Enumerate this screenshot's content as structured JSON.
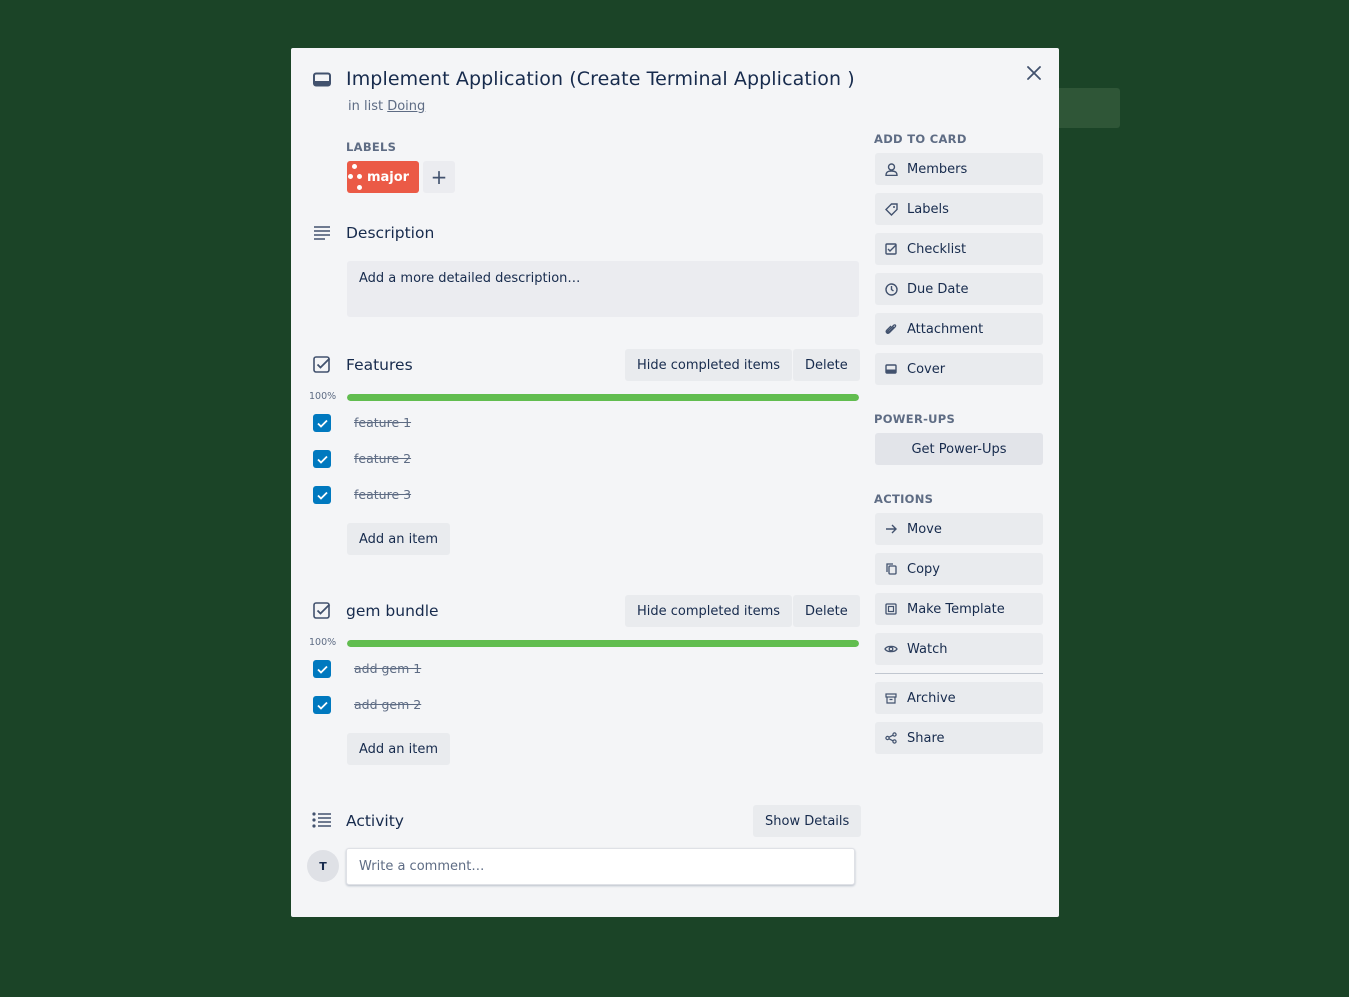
{
  "card": {
    "title": "Implement Application (Create Terminal Application )",
    "in_list_prefix": "in list",
    "list_name": "Doing"
  },
  "labels": {
    "heading": "LABELS",
    "items": [
      {
        "name": "major",
        "color": "#eb5a46"
      }
    ],
    "add_symbol": "+"
  },
  "description": {
    "title": "Description",
    "placeholder": "Add a more detailed description…"
  },
  "checklists": [
    {
      "title": "Features",
      "progress_label": "100%",
      "progress": 1.0,
      "hide_label": "Hide completed items",
      "delete_label": "Delete",
      "items": [
        {
          "text": "feature 1",
          "checked": true
        },
        {
          "text": "feature 2",
          "checked": true
        },
        {
          "text": "feature 3",
          "checked": true
        }
      ],
      "add_item_label": "Add an item"
    },
    {
      "title": "gem bundle",
      "progress_label": "100%",
      "progress": 1.0,
      "hide_label": "Hide completed items",
      "delete_label": "Delete",
      "items": [
        {
          "text": "add gem 1",
          "checked": true
        },
        {
          "text": "add gem 2",
          "checked": true
        }
      ],
      "add_item_label": "Add an item"
    }
  ],
  "activity": {
    "title": "Activity",
    "show_details_label": "Show Details",
    "avatar_initial": "T",
    "comment_placeholder": "Write a comment…"
  },
  "sidebar": {
    "add_to_card_heading": "ADD TO CARD",
    "add_to_card": [
      {
        "label": "Members",
        "icon": "person-icon"
      },
      {
        "label": "Labels",
        "icon": "tag-icon"
      },
      {
        "label": "Checklist",
        "icon": "checklist-icon"
      },
      {
        "label": "Due Date",
        "icon": "clock-icon"
      },
      {
        "label": "Attachment",
        "icon": "paperclip-icon"
      },
      {
        "label": "Cover",
        "icon": "cover-icon"
      }
    ],
    "power_ups_heading": "POWER-UPS",
    "get_power_ups_label": "Get Power-Ups",
    "actions_heading": "ACTIONS",
    "actions": [
      {
        "label": "Move",
        "icon": "arrow-right-icon"
      },
      {
        "label": "Copy",
        "icon": "copy-icon"
      },
      {
        "label": "Make Template",
        "icon": "template-icon"
      },
      {
        "label": "Watch",
        "icon": "eye-icon"
      },
      {
        "label": "Archive",
        "icon": "archive-icon"
      },
      {
        "label": "Share",
        "icon": "share-icon"
      }
    ]
  },
  "colors": {
    "board_background": "#1b4427",
    "modal_background": "#f4f5f7",
    "progress_complete": "#61bd4f",
    "checkbox": "#0079bf",
    "label_major": "#eb5a46"
  }
}
